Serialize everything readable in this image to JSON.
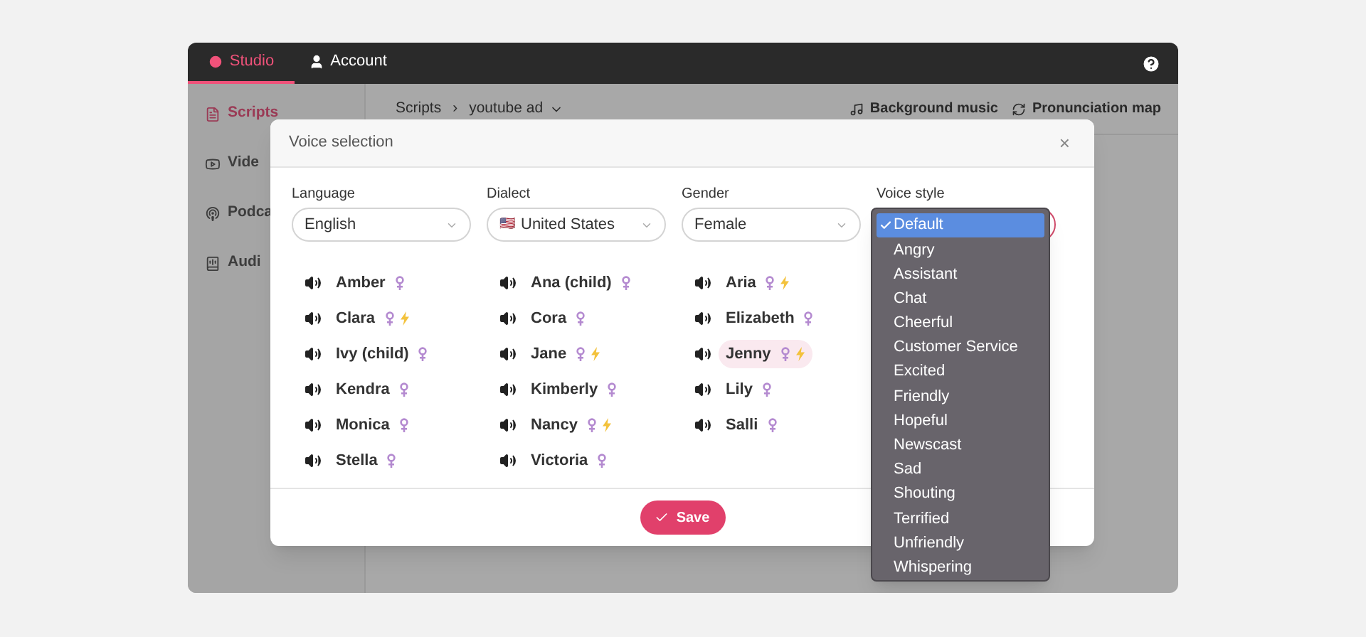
{
  "topbar": {
    "tabs": [
      {
        "label": "Studio",
        "selected": true
      },
      {
        "label": "Account",
        "selected": false
      }
    ]
  },
  "sidebar": {
    "items": [
      {
        "label": "Scripts",
        "selected": true
      },
      {
        "label": "Vide",
        "selected": false
      },
      {
        "label": "Podca",
        "selected": false
      },
      {
        "label": "Audi",
        "selected": false
      }
    ]
  },
  "breadcrumb": {
    "root": "Scripts",
    "separator": "›",
    "current": "youtube ad"
  },
  "toolbar": {
    "actions": [
      "Background music",
      "Pronunciation map"
    ]
  },
  "modal": {
    "title": "Voice selection",
    "close": "×",
    "filters": [
      {
        "label": "Language",
        "value": "English"
      },
      {
        "label": "Dialect",
        "value": "United States",
        "flag": "🇺🇸"
      },
      {
        "label": "Gender",
        "value": "Female"
      },
      {
        "label": "Voice style"
      }
    ],
    "voices": [
      {
        "name": "Amber",
        "lightning": false,
        "selected": false
      },
      {
        "name": "Ana (child)",
        "lightning": false,
        "selected": false
      },
      {
        "name": "Aria",
        "lightning": true,
        "selected": false
      },
      {
        "name": "Clara",
        "lightning": true,
        "selected": false
      },
      {
        "name": "Cora",
        "lightning": false,
        "selected": false
      },
      {
        "name": "Elizabeth",
        "lightning": false,
        "selected": false
      },
      {
        "name": "Ivy (child)",
        "lightning": false,
        "selected": false
      },
      {
        "name": "Jane",
        "lightning": true,
        "selected": false
      },
      {
        "name": "Jenny",
        "lightning": true,
        "selected": true
      },
      {
        "name": "Kendra",
        "lightning": false,
        "selected": false
      },
      {
        "name": "Kimberly",
        "lightning": false,
        "selected": false
      },
      {
        "name": "Lily",
        "lightning": false,
        "selected": false
      },
      {
        "name": "Monica",
        "lightning": false,
        "selected": false
      },
      {
        "name": "Nancy",
        "lightning": true,
        "selected": false
      },
      {
        "name": "Salli",
        "lightning": false,
        "selected": false
      },
      {
        "name": "Stella",
        "lightning": false,
        "selected": false
      },
      {
        "name": "Victoria",
        "lightning": false,
        "selected": false
      }
    ],
    "save": "Save"
  },
  "style_menu": {
    "items": [
      {
        "label": "Default",
        "selected": true
      },
      {
        "label": "Angry",
        "selected": false
      },
      {
        "label": "Assistant",
        "selected": false
      },
      {
        "label": "Chat",
        "selected": false
      },
      {
        "label": "Cheerful",
        "selected": false
      },
      {
        "label": "Customer Service",
        "selected": false
      },
      {
        "label": "Excited",
        "selected": false
      },
      {
        "label": "Friendly",
        "selected": false
      },
      {
        "label": "Hopeful",
        "selected": false
      },
      {
        "label": "Newscast",
        "selected": false
      },
      {
        "label": "Sad",
        "selected": false
      },
      {
        "label": "Shouting",
        "selected": false
      },
      {
        "label": "Terrified",
        "selected": false
      },
      {
        "label": "Unfriendly",
        "selected": false
      },
      {
        "label": "Whispering",
        "selected": false
      }
    ]
  }
}
